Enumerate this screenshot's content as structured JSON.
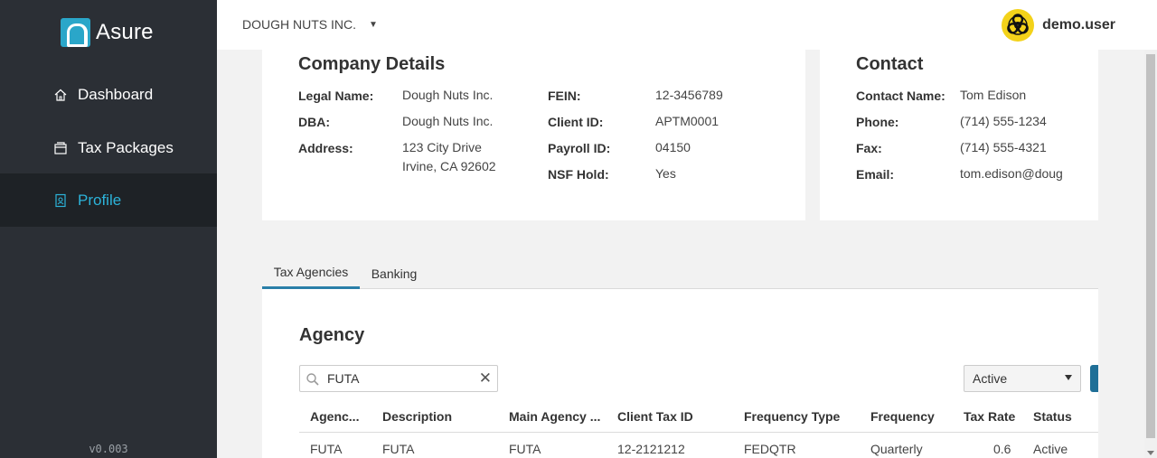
{
  "brand": {
    "name": "Asure"
  },
  "sidebar": {
    "items": [
      {
        "label": "Dashboard",
        "icon": "home-icon"
      },
      {
        "label": "Tax Packages",
        "icon": "package-icon"
      },
      {
        "label": "Profile",
        "icon": "badge-icon",
        "active": true
      }
    ],
    "version": "v0.003"
  },
  "topbar": {
    "company": "DOUGH NUTS INC.",
    "username": "demo.user",
    "avatar_icon": "biohazard-icon"
  },
  "company_details": {
    "title": "Company Details",
    "legal_name_label": "Legal Name:",
    "legal_name": "Dough Nuts Inc.",
    "dba_label": "DBA:",
    "dba": "Dough Nuts Inc.",
    "address_label": "Address:",
    "address_line1": "123 City Drive",
    "address_line2": "Irvine, CA 92602",
    "fein_label": "FEIN:",
    "fein": "12-3456789",
    "client_id_label": "Client ID:",
    "client_id": "APTM0001",
    "payroll_id_label": "Payroll ID:",
    "payroll_id": "04150",
    "nsf_hold_label": "NSF Hold:",
    "nsf_hold": "Yes"
  },
  "contact": {
    "title": "Contact",
    "name_label": "Contact Name:",
    "name": "Tom Edison",
    "phone_label": "Phone:",
    "phone": "(714) 555-1234",
    "fax_label": "Fax:",
    "fax": "(714) 555-4321",
    "email_label": "Email:",
    "email": "tom.edison@doug"
  },
  "tabs": [
    {
      "label": "Tax Agencies",
      "active": true
    },
    {
      "label": "Banking"
    }
  ],
  "agency": {
    "title": "Agency",
    "search_value": "FUTA",
    "status_filter": "Active",
    "columns": [
      "Agenc...",
      "Description",
      "Main Agency ...",
      "Client Tax ID",
      "Frequency Type",
      "Frequency",
      "Tax Rate",
      "Status"
    ],
    "rows": [
      [
        "FUTA",
        "FUTA",
        "FUTA",
        "12-2121212",
        "FEDQTR",
        "Quarterly",
        "0.6",
        "Active"
      ]
    ]
  },
  "colors": {
    "sidebar_bg": "#2b2f35",
    "accent": "#2cb3d9",
    "tab_underline": "#2a7fa8",
    "avatar_bg": "#f3d21a"
  }
}
